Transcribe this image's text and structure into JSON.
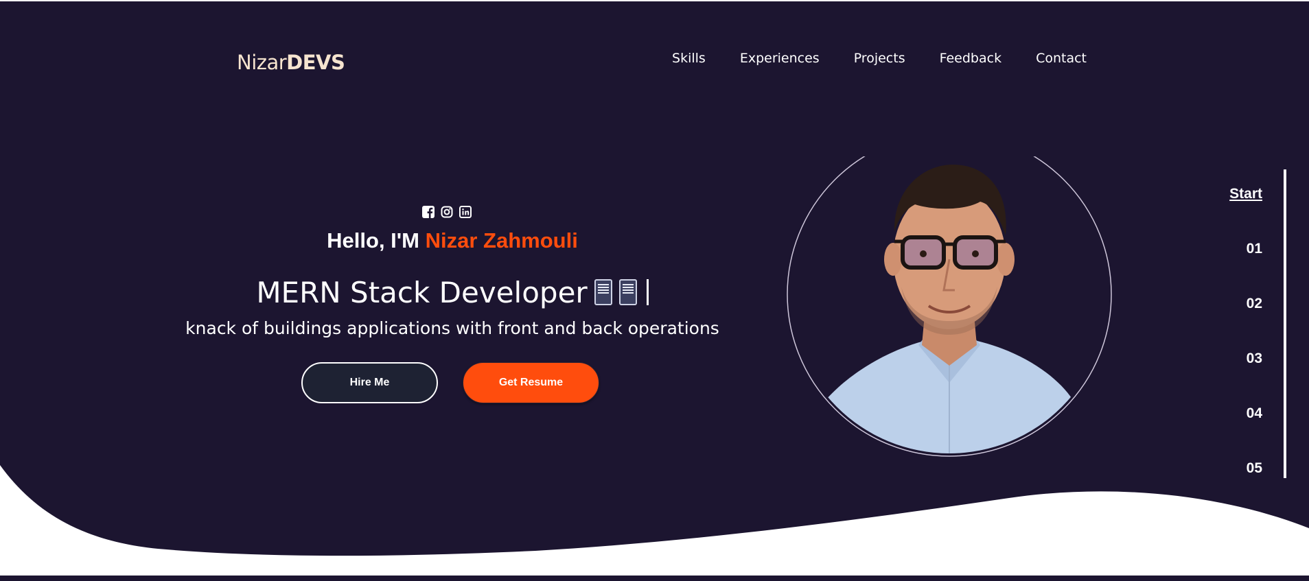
{
  "brand": {
    "logo_light": "Nizar",
    "logo_bold": "DEVS"
  },
  "nav": {
    "items": [
      "Skills",
      "Experiences",
      "Projects",
      "Feedback",
      "Contact"
    ]
  },
  "social_icons": [
    "facebook-icon",
    "instagram-icon",
    "linkedin-icon"
  ],
  "hero": {
    "hello_prefix": "Hello, I'M ",
    "name": "Nizar Zahmouli",
    "role": "MERN Stack Developer",
    "tagline": "knack of buildings applications with front and back operations",
    "hire_button": "Hire Me",
    "resume_button": "Get Resume"
  },
  "side_nav": {
    "items": [
      "Start",
      "01",
      "02",
      "03",
      "04",
      "05"
    ],
    "active": "Start"
  },
  "colors": {
    "background": "#1c1530",
    "accent": "#ff4d0d",
    "logo": "#f6e4cf",
    "hire_button_bg": "#1e2233"
  }
}
